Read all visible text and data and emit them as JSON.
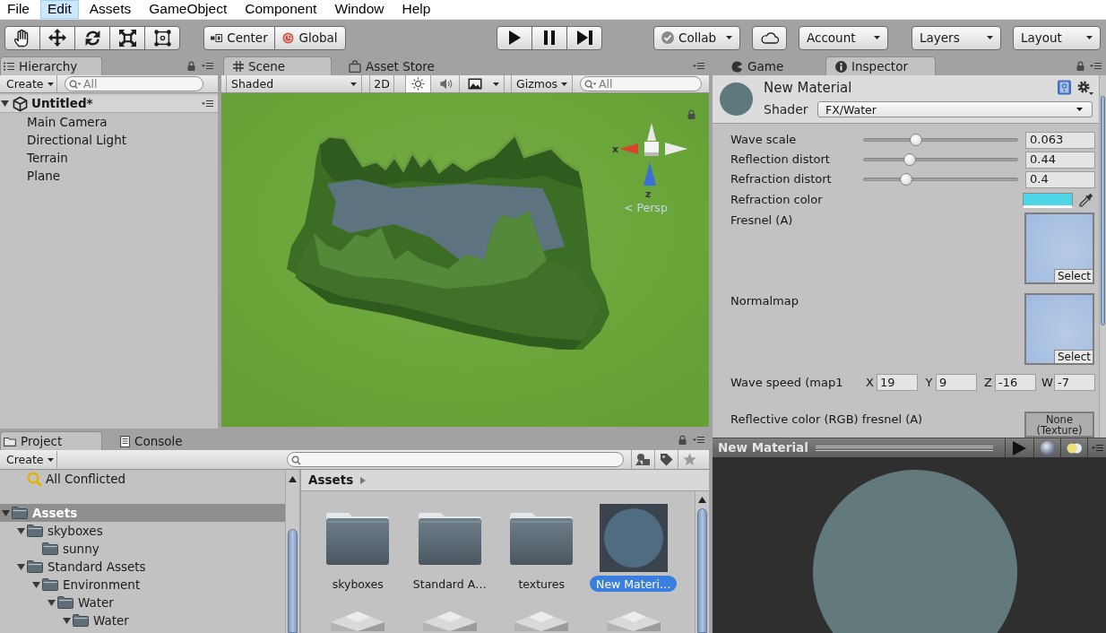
{
  "menu": [
    {
      "label": "File",
      "highlighted": false
    },
    {
      "label": "Edit",
      "highlighted": true
    },
    {
      "label": "Assets",
      "highlighted": false
    },
    {
      "label": "GameObject",
      "highlighted": false
    },
    {
      "label": "Component",
      "highlighted": false
    },
    {
      "label": "Window",
      "highlighted": false
    },
    {
      "label": "Help",
      "highlighted": false
    }
  ],
  "toolbar": {
    "pivot_mode": "Center",
    "pivot_rotation": "Global",
    "collab": "Collab",
    "account": "Account",
    "layers": "Layers",
    "layout": "Layout"
  },
  "hierarchy": {
    "tab": "Hierarchy",
    "create": "Create",
    "search_placeholder": "All",
    "scene": {
      "label": "Untitled*",
      "expanded": true,
      "children": [
        {
          "label": "Main Camera",
          "selected": false
        },
        {
          "label": "Directional Light",
          "selected": false
        },
        {
          "label": "Terrain",
          "selected": false
        },
        {
          "label": "Plane",
          "selected": false
        }
      ]
    }
  },
  "scene_view": {
    "tabs": [
      {
        "label": "Scene",
        "selected": true
      },
      {
        "label": "Asset Store",
        "selected": false
      }
    ],
    "shading": "Shaded",
    "mode_2d": "2D",
    "lighting_on": true,
    "audio_on": false,
    "gizmos": "Gizmos",
    "search_placeholder": "All",
    "axis_labels": [
      "x",
      "z"
    ],
    "projection": "< Persp"
  },
  "inspector": {
    "tabs": [
      {
        "label": "Game",
        "selected": false
      },
      {
        "label": "Inspector",
        "selected": true
      }
    ],
    "title": "New Material",
    "shader_label": "Shader",
    "shader": "FX/Water",
    "properties": [
      {
        "kind": "slider",
        "label": "Wave scale",
        "level": 0.34,
        "value": "0.063"
      },
      {
        "kind": "slider",
        "label": "Reflection distort",
        "level": 0.3,
        "value": "0.44"
      },
      {
        "kind": "slider",
        "label": "Refraction distort",
        "level": 0.28,
        "value": "0.4"
      },
      {
        "kind": "color",
        "label": "Refraction color",
        "color": "#4dd5e8"
      },
      {
        "kind": "texture",
        "label": "Fresnel (A)",
        "button": "Select"
      },
      {
        "kind": "texture",
        "label": "Normalmap",
        "button": "Select"
      },
      {
        "kind": "vector",
        "label": "Wave speed (map1",
        "components": [
          {
            "axis": "X",
            "value": "19"
          },
          {
            "axis": "Y",
            "value": "9"
          },
          {
            "axis": "Z",
            "value": "-16"
          },
          {
            "axis": "W",
            "value": "-7"
          }
        ]
      },
      {
        "kind": "texture_empty",
        "label": "Reflective color (RGB) fresnel (A)",
        "value": "None (Texture)"
      }
    ]
  },
  "preview": {
    "title": "New Material"
  },
  "project": {
    "tabs": [
      {
        "label": "Project",
        "selected": true
      },
      {
        "label": "Console",
        "selected": false
      }
    ],
    "create": "Create",
    "favorites": [
      {
        "label": "All Conflicted"
      }
    ],
    "tree": [
      {
        "label": "Assets",
        "selected": true,
        "expanded": true,
        "children": [
          {
            "label": "skyboxes",
            "selected": false,
            "expanded": true,
            "children": [
              {
                "label": "sunny",
                "selected": false
              }
            ]
          },
          {
            "label": "Standard Assets",
            "selected": false,
            "expanded": true,
            "children": [
              {
                "label": "Environment",
                "selected": false,
                "expanded": true,
                "children": [
                  {
                    "label": "Water",
                    "selected": false,
                    "expanded": true,
                    "children": [
                      {
                        "label": "Water",
                        "selected": false,
                        "expanded": true
                      }
                    ]
                  }
                ]
              }
            ]
          }
        ]
      }
    ],
    "breadcrumb": "Assets",
    "items": [
      {
        "label": "skyboxes",
        "kind": "folder",
        "selected": false
      },
      {
        "label": "Standard A…",
        "kind": "folder",
        "selected": false
      },
      {
        "label": "textures",
        "kind": "folder",
        "selected": false
      },
      {
        "label": "New Materi…",
        "kind": "material",
        "selected": true
      },
      {
        "kind": "model",
        "selected": false
      },
      {
        "kind": "model",
        "selected": false
      },
      {
        "kind": "model",
        "selected": false
      },
      {
        "kind": "model",
        "selected": false
      }
    ]
  }
}
